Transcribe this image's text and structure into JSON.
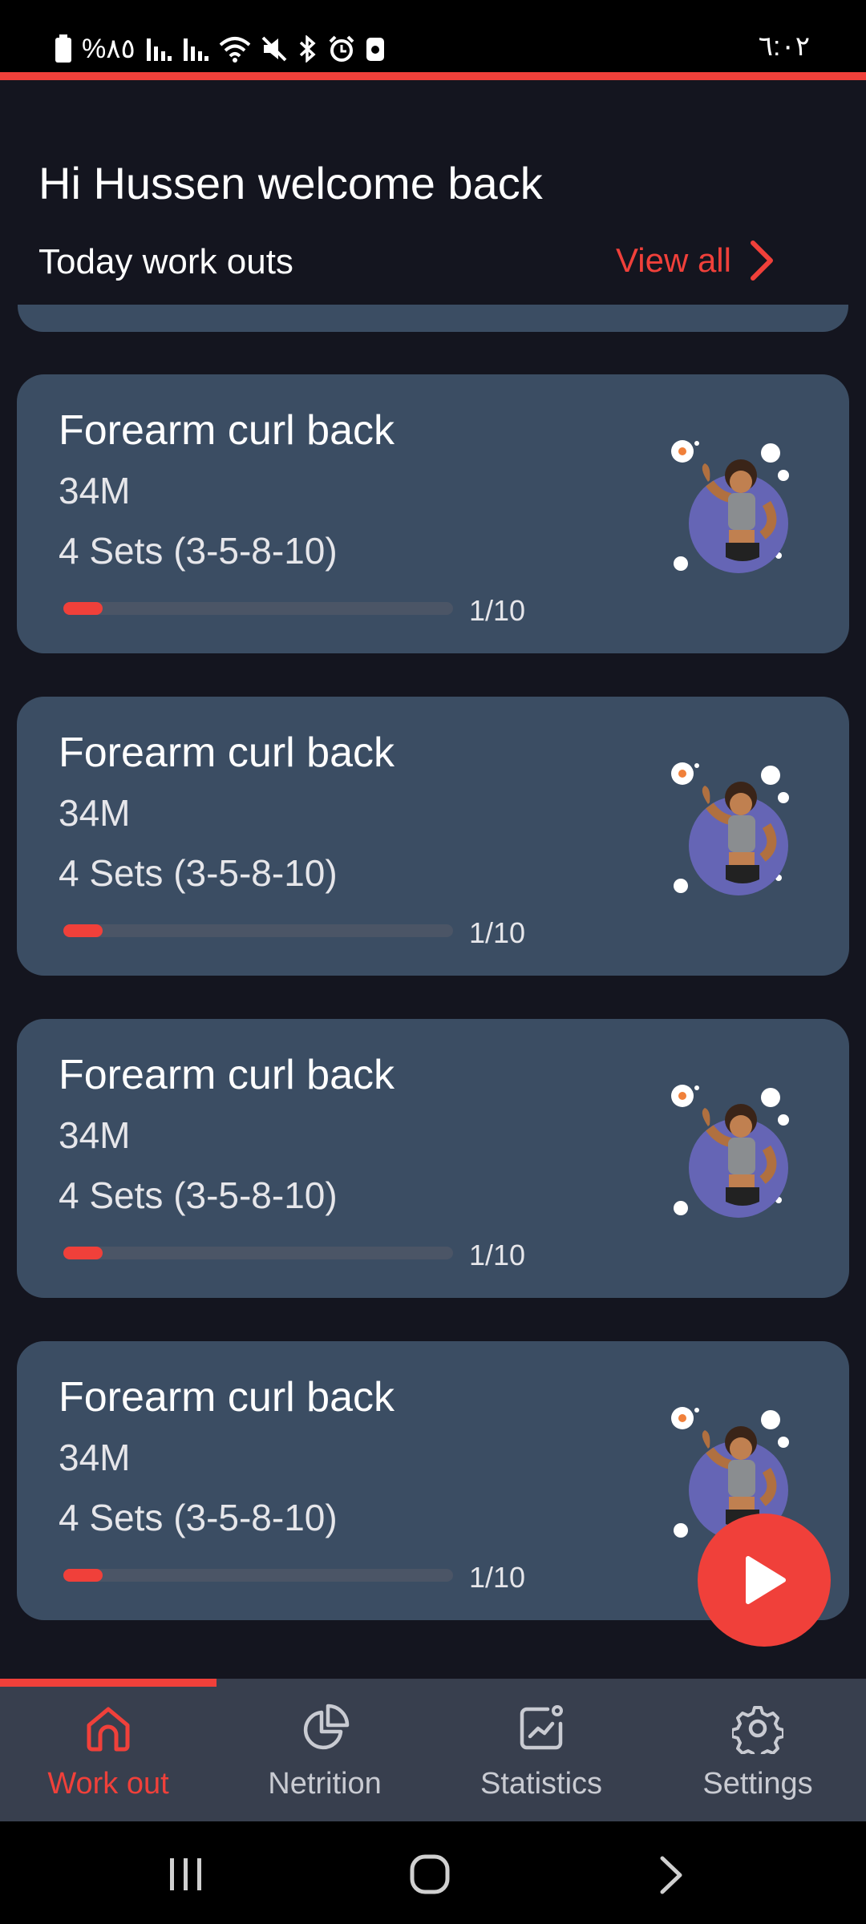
{
  "status_bar": {
    "battery_text": "%٨٥",
    "time": "٦:٠٢",
    "icons": [
      "battery-icon",
      "signal-icon",
      "signal-icon",
      "wifi-icon",
      "mute-icon",
      "bluetooth-icon",
      "alarm-icon",
      "screenshot-icon"
    ]
  },
  "header": {
    "greeting": "Hi Hussen welcome back",
    "section_title": "Today work outs",
    "view_all": "View all"
  },
  "workouts": [
    {
      "title": "Forearm curl back",
      "duration": "34M",
      "sets": "4 Sets (3-5-8-10)",
      "progress_text": "1/10",
      "progress": 0.1
    },
    {
      "title": "Forearm curl back",
      "duration": "34M",
      "sets": "4 Sets (3-5-8-10)",
      "progress_text": "1/10",
      "progress": 0.1
    },
    {
      "title": "Forearm curl back",
      "duration": "34M",
      "sets": "4 Sets (3-5-8-10)",
      "progress_text": "1/10",
      "progress": 0.1
    },
    {
      "title": "Forearm curl back",
      "duration": "34M",
      "sets": "4 Sets (3-5-8-10)",
      "progress_text": "1/10",
      "progress": 0.1
    }
  ],
  "fab": {
    "icon": "play-icon"
  },
  "bottom_nav": {
    "items": [
      {
        "label": "Work out",
        "icon": "home-icon",
        "active": true
      },
      {
        "label": "Netrition",
        "icon": "pie-chart-icon",
        "active": false
      },
      {
        "label": "Statistics",
        "icon": "chart-icon",
        "active": false
      },
      {
        "label": "Settings",
        "icon": "gear-icon",
        "active": false
      }
    ]
  },
  "colors": {
    "accent": "#f0403a",
    "background": "#14151f",
    "card": "#3b4d63",
    "nav_bg": "#383f4e"
  }
}
